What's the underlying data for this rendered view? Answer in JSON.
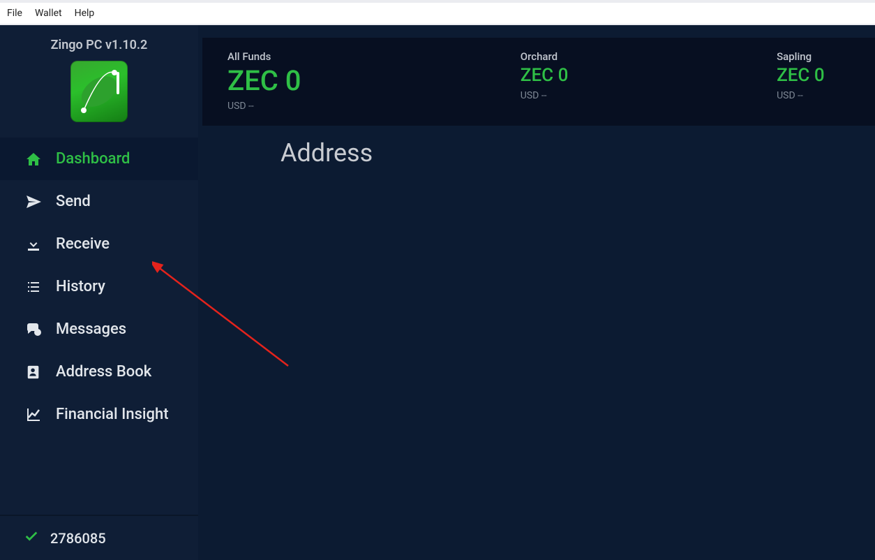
{
  "menubar": {
    "items": [
      "File",
      "Wallet",
      "Help"
    ]
  },
  "app": {
    "title": "Zingo PC v1.10.2"
  },
  "sidebar": {
    "items": [
      {
        "label": "Dashboard",
        "icon": "home-icon",
        "active": true
      },
      {
        "label": "Send",
        "icon": "send-icon"
      },
      {
        "label": "Receive",
        "icon": "download-icon"
      },
      {
        "label": "History",
        "icon": "list-icon"
      },
      {
        "label": "Messages",
        "icon": "chat-icon"
      },
      {
        "label": "Address Book",
        "icon": "addressbook-icon"
      },
      {
        "label": "Financial Insight",
        "icon": "chart-icon"
      }
    ]
  },
  "status": {
    "block_height": "2786085"
  },
  "balances": [
    {
      "label": "All Funds",
      "currency": "ZEC",
      "amount": "0",
      "usd": "USD --",
      "size": "big"
    },
    {
      "label": "Orchard",
      "currency": "ZEC",
      "amount": "0",
      "usd": "USD --",
      "size": "small"
    },
    {
      "label": "Sapling",
      "currency": "ZEC",
      "amount": "0",
      "usd": "USD --",
      "size": "small"
    }
  ],
  "main": {
    "address_label": "Address"
  }
}
